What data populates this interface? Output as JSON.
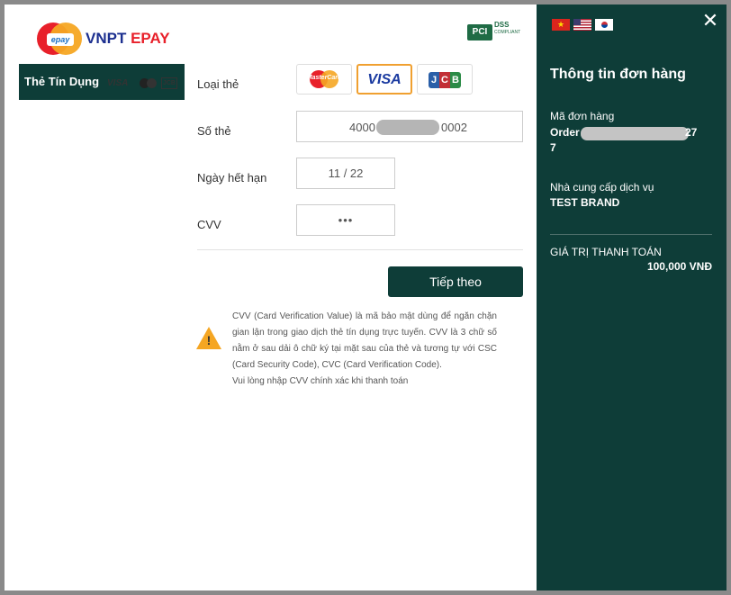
{
  "logo": {
    "tag": "epay",
    "brand_part1": "VNPT ",
    "brand_part2": "EPAY"
  },
  "pci": {
    "pci": "PCI",
    "dss": "DSS",
    "compliant": "COMPLIANT"
  },
  "method_tab": {
    "label": "Thẻ Tín Dụng",
    "visa": "VISA",
    "jcb": "JCB"
  },
  "form": {
    "card_type_label": "Loại thẻ",
    "card_options": {
      "mastercard": "MasterCard",
      "visa": "VISA",
      "jcb": [
        "J",
        "C",
        "B"
      ]
    },
    "selected_card": "visa",
    "card_number_label": "Số thẻ",
    "card_number_start": "4000",
    "card_number_end": "0002",
    "expiry_label": "Ngày hết hạn",
    "expiry_value": "11 / 22",
    "cvv_label": "CVV",
    "cvv_value": "•••",
    "next_button": "Tiếp theo"
  },
  "cvv_note": {
    "line1": "CVV (Card Verification Value) là mã bảo mật dùng để ngăn chặn gian lận trong giao dịch thẻ tín dụng trực tuyến. CVV là 3 chữ số nằm ở sau dải ô chữ ký tại mặt sau của thẻ và tương tự với CSC (Card Security Code), CVC (Card Verification Code).",
    "line2": "Vui lòng nhập CVV chính xác khi thanh toán"
  },
  "order_panel": {
    "title": "Thông tin đơn hàng",
    "order_id_label": "Mã đơn hàng",
    "order_id_start": "Order",
    "order_id_tail": "27",
    "order_id_wrap": "7",
    "provider_label": "Nhà cung cấp dịch vụ",
    "provider": "TEST BRAND",
    "total_label": "GIÁ TRỊ THANH TOÁN",
    "total": "100,000 VNĐ",
    "languages": [
      "vi",
      "en",
      "ko"
    ]
  },
  "colors": {
    "primary": "#0e3d38",
    "accent": "#f0a030",
    "brand_red": "#e8202a",
    "brand_blue": "#1c2f8f"
  }
}
